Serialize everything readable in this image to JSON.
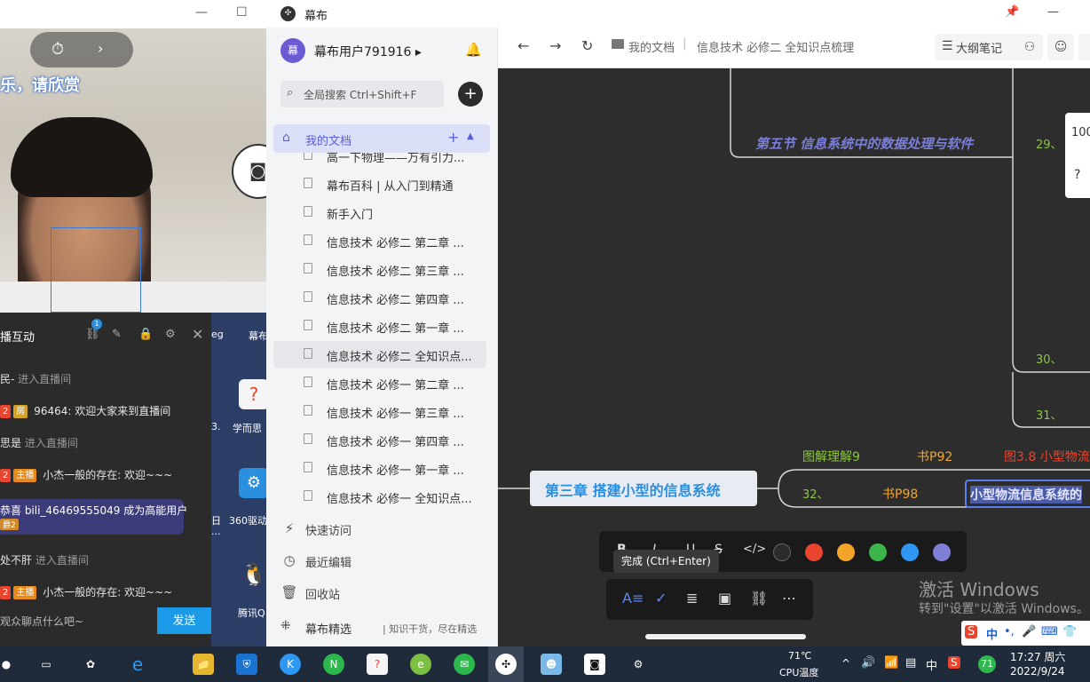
{
  "stream": {
    "caption": "乐，请欣赏",
    "panel_title": "播互动",
    "badge": "1",
    "messages": [
      {
        "text": "民-",
        "muted": " 进入直播间",
        "tag": "",
        "tagcolor": ""
      },
      {
        "text": " 96464: 欢迎大家来到直播间",
        "muted": "",
        "tag": "房",
        "tagcolor": "gold"
      },
      {
        "text": "思是",
        "muted": " 进入直播间",
        "tag": "",
        "tagcolor": ""
      },
      {
        "text": " 小杰一般的存在: 欢迎~~~",
        "muted": "",
        "tag": "主播",
        "tagcolor": "orange"
      },
      {
        "text": "处不肝",
        "muted": " 进入直播间",
        "tag": "",
        "tagcolor": ""
      },
      {
        "text": " 小杰一般的存在: 欢迎~~~",
        "muted": "",
        "tag": "主播",
        "tagcolor": "orange"
      }
    ],
    "highlight_line": "恭喜 bili_46469555049 成为高能用户",
    "highlight_tag": "爵2",
    "input_placeholder": "观众聊点什么吧~",
    "send_label": "发送"
  },
  "desktop": {
    "label_top": "幕布",
    "label_top_left": "eg",
    "icon1_label": "学而思",
    "icon1_prefix": "3.",
    "icon2_label": "360驱动",
    "icon2_prefix": "日",
    "icon3_label": "腾讯Q",
    "icon3_prefix": "..."
  },
  "app": {
    "title": "幕布",
    "user": "幕布用户791916 ▸",
    "avatar": "幕",
    "search_placeholder": "全局搜索 Ctrl+Shift+F",
    "mydocs": "我的文档",
    "docs": [
      {
        "label": "高一下物理——万有引力...",
        "active": false
      },
      {
        "label": "幕布百科 | 从入门到精通",
        "active": false
      },
      {
        "label": "新手入门",
        "active": false
      },
      {
        "label": "信息技术 必修二 第二章 ...",
        "active": false
      },
      {
        "label": "信息技术 必修二 第三章 ...",
        "active": false
      },
      {
        "label": "信息技术 必修二 第四章 ...",
        "active": false
      },
      {
        "label": "信息技术 必修二 第一章 ...",
        "active": false
      },
      {
        "label": "信息技术 必修二 全知识点...",
        "active": true
      },
      {
        "label": "信息技术 必修一 第二章 ...",
        "active": false
      },
      {
        "label": "信息技术 必修一 第三章 ...",
        "active": false
      },
      {
        "label": "信息技术 必修一 第四章 ...",
        "active": false
      },
      {
        "label": "信息技术 必修一 第一章 ...",
        "active": false
      },
      {
        "label": "信息技术 必修一 全知识点...",
        "active": false
      }
    ],
    "nav": [
      {
        "icon": "lightning-icon",
        "glyph": "⚡",
        "label": "快速访问"
      },
      {
        "icon": "clock-icon",
        "glyph": "◷",
        "label": "最近编辑"
      },
      {
        "icon": "trash-icon",
        "glyph": "🗑",
        "label": "回收站"
      }
    ],
    "footer_label": "幕布精选",
    "footer_sub": "| 知识干货，尽在精选"
  },
  "topbar": {
    "crumb1": "我的文档",
    "crumb2": "信息技术 必修二 全知识点梳理",
    "outline": "大纲笔记"
  },
  "mindmap": {
    "node_section5": "第五节 信息系统中的数据处理与软件",
    "num29": "29、",
    "num30": "30、",
    "num31": "31、",
    "chapter3": "第三章 搭建小型的信息系统",
    "num32": "32、",
    "tujie": "图解理解9",
    "shu92": "书P92",
    "fig38": "图3.8 小型物流",
    "shu98": "书P98",
    "editing": "小型物流信息系统的",
    "zoom": "100"
  },
  "toolbar": {
    "tooltip": "完成 (Ctrl+Enter)",
    "colors": [
      "#2b2b2b",
      "#e8442e",
      "#f4a529",
      "#3cb54a",
      "#2e97f2",
      "#7f7fd6"
    ]
  },
  "watermark": {
    "line1": "激活 Windows",
    "line2": "转到\"设置\"以激活 Windows。"
  },
  "tray": {
    "temp": "71℃",
    "temp_label": "CPU温度",
    "ime": "中",
    "badge": "71",
    "time": "17:27 周六",
    "date": "2022/9/24"
  }
}
